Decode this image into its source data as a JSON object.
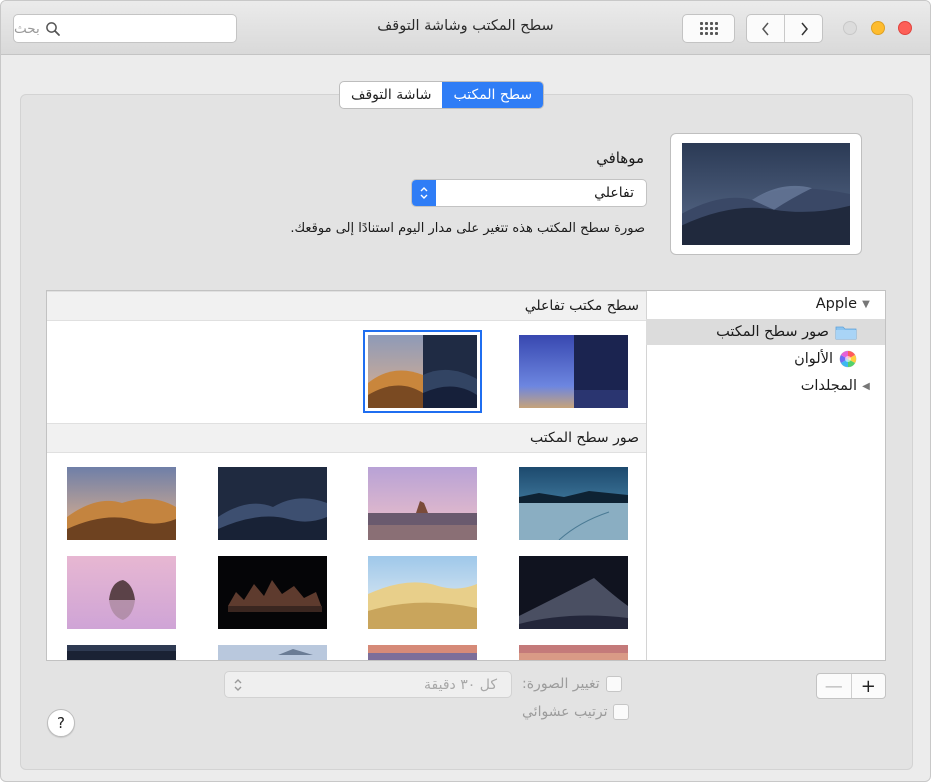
{
  "window": {
    "title": "سطح المكتب وشاشة التوقف",
    "search_placeholder": "بحث"
  },
  "tabs": [
    {
      "label": "سطح المكتب",
      "active": true
    },
    {
      "label": "شاشة التوقف",
      "active": false
    }
  ],
  "wallpaper": {
    "name": "موهافي",
    "mode_value": "تفاعلي",
    "description": "صورة سطح المكتب هذه تتغير على مدار اليوم استنادًا إلى موقعك."
  },
  "sidebar": {
    "items": [
      {
        "label": "Apple",
        "icon": "disclosure-triangle-open-icon",
        "selected": false
      },
      {
        "label": "صور سطح المكتب",
        "icon": "folder-icon",
        "selected": true
      },
      {
        "label": "الألوان",
        "icon": "color-wheel-icon",
        "selected": false
      },
      {
        "label": "المجلدات",
        "icon": "disclosure-triangle-closed-icon",
        "selected": false
      }
    ]
  },
  "sections": {
    "dynamic_header": "سطح مكتب تفاعلي",
    "pictures_header": "صور سطح المكتب"
  },
  "thumbnails": {
    "dynamic": [
      "catalina-dynamic",
      "mojave-dynamic"
    ],
    "pictures": [
      "lake-dusk",
      "desert-pinnacle",
      "mojave-night",
      "mojave-day",
      "dunes-night",
      "dunes-day",
      "tufa-night",
      "rock-pink",
      "partial-row-1",
      "partial-row-2",
      "partial-row-3",
      "partial-row-4"
    ],
    "selected": "mojave-dynamic"
  },
  "controls": {
    "change_picture_label": "تغيير الصورة:",
    "change_picture_checked": false,
    "interval_value": "كل ٣٠ دقيقة",
    "random_order_label": "ترتيب عشوائي",
    "random_order_checked": false,
    "add_symbol": "+",
    "remove_symbol": "—",
    "help_symbol": "?"
  },
  "colors": {
    "accent": "#2f7df6",
    "selection_outline": "#1f6ef0",
    "close": "#fd5f57",
    "minimize": "#febc2e"
  }
}
